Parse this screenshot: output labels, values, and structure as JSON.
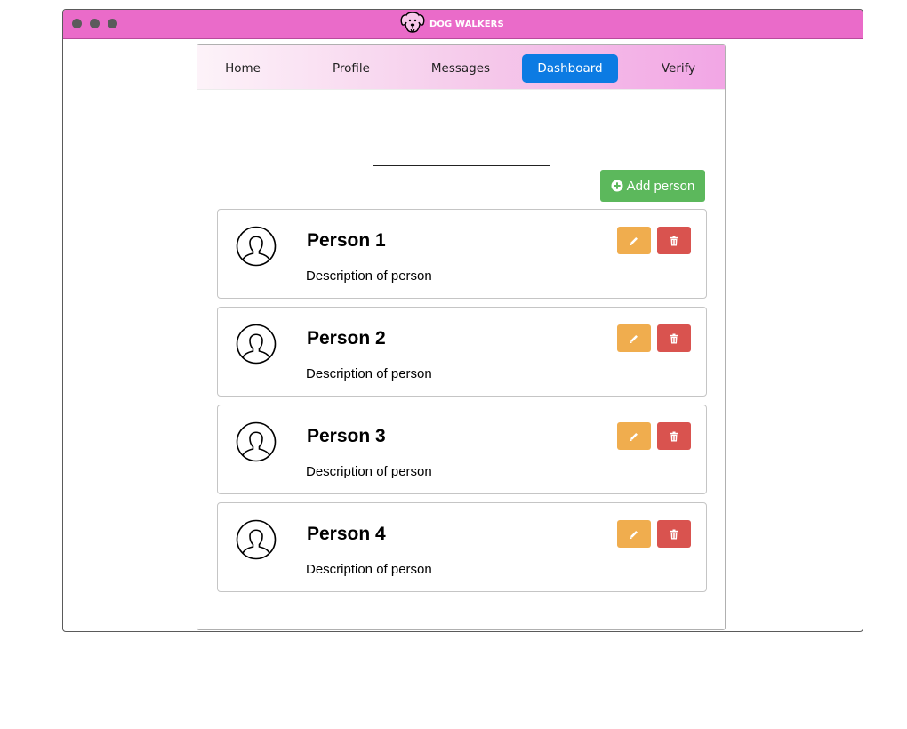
{
  "window": {
    "brand_name": "DOG WALKERS",
    "colors": {
      "titlebar": "#ea6bc9",
      "traffic_light": "#5b5b5b"
    },
    "controls": [
      "window-dot",
      "window-dot",
      "window-dot"
    ]
  },
  "nav": {
    "items": [
      {
        "label": "Home"
      },
      {
        "label": "Profile"
      },
      {
        "label": "Messages"
      },
      {
        "label": "Dashboard",
        "active": true
      },
      {
        "label": "Verify"
      }
    ],
    "colors": {
      "active_bg": "#0c7be3",
      "gradient_start": "#fdf3f9",
      "gradient_end": "#f2a6e5"
    }
  },
  "actions": {
    "add_person_label": "Add person",
    "add_person_icon": "plus-circle-icon",
    "color": "#5cb85c"
  },
  "people": [
    {
      "name": "Person 1",
      "description": "Description of person"
    },
    {
      "name": "Person 2",
      "description": "Description of person"
    },
    {
      "name": "Person 3",
      "description": "Description of person"
    },
    {
      "name": "Person 4",
      "description": "Description of person"
    }
  ],
  "card_actions": {
    "edit_icon": "pencil-icon",
    "delete_icon": "trash-icon",
    "edit_color": "#f0ad4e",
    "delete_color": "#d9534f"
  }
}
